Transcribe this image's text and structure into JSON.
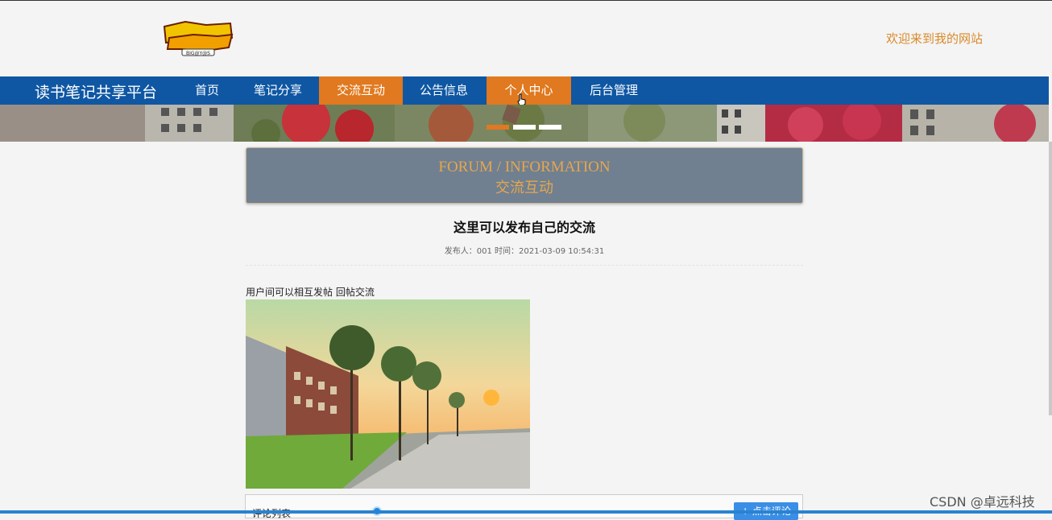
{
  "header": {
    "logo_text": "BIG@Y@S",
    "welcome": "欢迎来到我的网站"
  },
  "nav": {
    "brand": "读书笔记共享平台",
    "items": [
      {
        "label": "首页",
        "active": false
      },
      {
        "label": "笔记分享",
        "active": false
      },
      {
        "label": "交流互动",
        "active": true
      },
      {
        "label": "公告信息",
        "active": false
      },
      {
        "label": "个人中心",
        "active": true
      },
      {
        "label": "后台管理",
        "active": false
      }
    ]
  },
  "banner": {
    "slide_count": 3,
    "active_slide": 1
  },
  "section_title": {
    "en": "FORUM / INFORMATION",
    "cn": "交流互动"
  },
  "post": {
    "title": "这里可以发布自己的交流",
    "meta": "发布人：001 时间：2021-03-09 10:54:31",
    "content": "用户间可以相互发帖 回帖交流"
  },
  "comments": {
    "label": "评论列表",
    "button": "+ 点击评论"
  },
  "watermark": "CSDN @卓远科技",
  "colors": {
    "nav_bg": "#0f57a3",
    "accent": "#e0791f",
    "title_box_bg": "#708090",
    "title_text": "#e6a64f"
  }
}
